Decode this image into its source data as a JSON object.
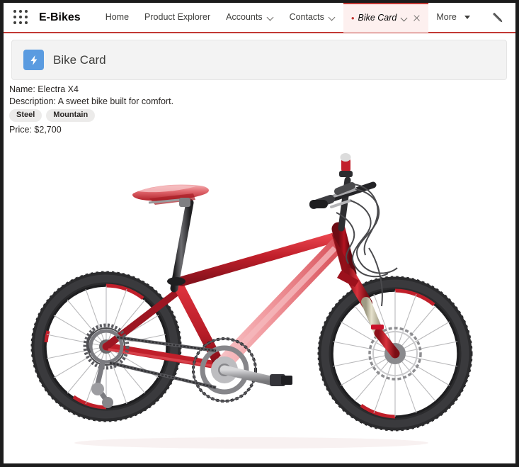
{
  "app": {
    "launcher_icon": "app-launcher-grid-icon",
    "name": "E-Bikes"
  },
  "nav": {
    "items": [
      {
        "label": "Home",
        "has_chevron": false
      },
      {
        "label": "Product Explorer",
        "has_chevron": false
      },
      {
        "label": "Accounts",
        "has_chevron": true
      },
      {
        "label": "Contacts",
        "has_chevron": true
      }
    ],
    "active_tab": {
      "label": "Bike Card",
      "unsaved_marker": "•",
      "has_chevron": true,
      "has_close": true
    },
    "more": {
      "label": "More",
      "caret": "▾"
    },
    "edit_icon": "pencil-icon"
  },
  "card": {
    "icon": "lightning-bolt-icon",
    "icon_color": "#5a9be0",
    "title": "Bike Card"
  },
  "record": {
    "name_line": "Name: Electra X4",
    "description_line": "Description: A sweet bike built for comfort.",
    "badges": [
      "Steel",
      "Mountain"
    ],
    "price_line": "Price: $2,700"
  },
  "photo": {
    "alt": "Red mountain bike, side view, facing right",
    "frame_color": "#c01f2a",
    "frame_dark": "#7d0d17",
    "frame_light": "#f3a0a5",
    "tire_color": "#2e2e30",
    "accent_red": "#c8202b",
    "metal_color": "#9a9a9c",
    "background": "#ffffff"
  },
  "theme": {
    "accent": "#c23934",
    "tab_bg": "#fdf0ef",
    "panel_bg": "#f3f3f3",
    "text": "#3e3e3c",
    "border_frame": "#1c1c1c"
  }
}
